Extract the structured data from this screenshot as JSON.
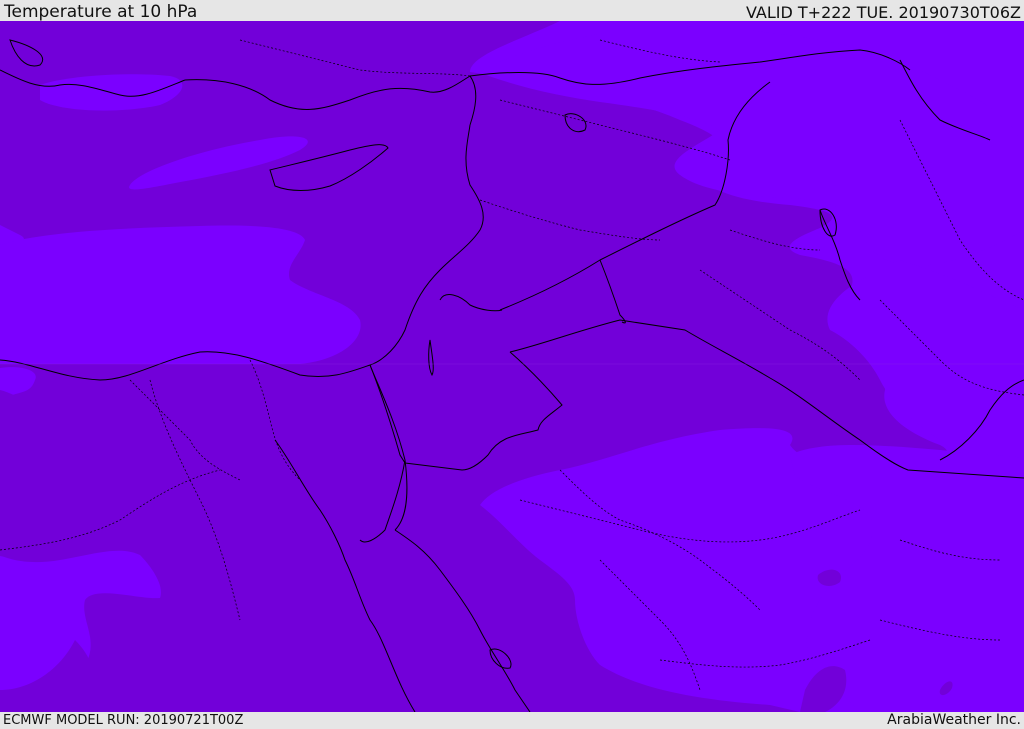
{
  "header": {
    "title": "Temperature at 10 hPa",
    "valid_time": "VALID T+222 TUE. 20190730T06Z"
  },
  "footer": {
    "model_run": "ECMWF MODEL RUN: 20190721T00Z",
    "credit": "ArabiaWeather Inc."
  },
  "map": {
    "field": "Temperature at 10 hPa",
    "colors": {
      "warm_band": "#7b00ff",
      "cool_band": "#7200d9",
      "border": "#000000"
    }
  }
}
